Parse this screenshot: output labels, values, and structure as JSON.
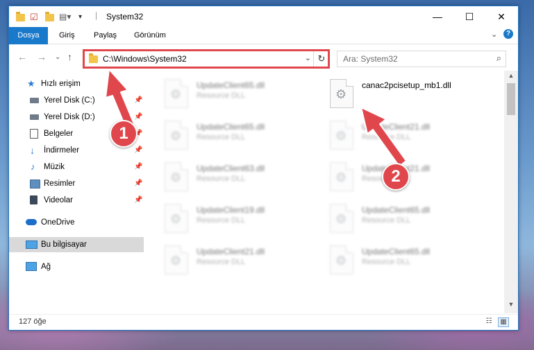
{
  "window": {
    "title": "System32",
    "controls": {
      "minimize": "—",
      "maximize": "☐",
      "close": "✕"
    }
  },
  "ribbon": {
    "tabs": [
      "Dosya",
      "Giriş",
      "Paylaş",
      "Görünüm"
    ]
  },
  "address": {
    "path": "C:\\Windows\\System32"
  },
  "search": {
    "placeholder": "Ara: System32"
  },
  "nav_pane": {
    "items": [
      {
        "label": "Hızlı erişim",
        "icon": "star-icon",
        "pinned": false
      },
      {
        "label": "Yerel Disk (C:)",
        "icon": "drive-icon",
        "pinned": true
      },
      {
        "label": "Yerel Disk (D:)",
        "icon": "drive-icon",
        "pinned": true
      },
      {
        "label": "Belgeler",
        "icon": "documents-icon",
        "pinned": true
      },
      {
        "label": "İndirmeler",
        "icon": "download-icon",
        "pinned": true
      },
      {
        "label": "Müzik",
        "icon": "music-icon",
        "pinned": true
      },
      {
        "label": "Resimler",
        "icon": "pictures-icon",
        "pinned": true
      },
      {
        "label": "Videolar",
        "icon": "videos-icon",
        "pinned": true
      },
      {
        "label": "OneDrive",
        "icon": "cloud-icon",
        "pinned": false
      },
      {
        "label": "Bu bilgisayar",
        "icon": "computer-icon",
        "pinned": false,
        "selected": true
      },
      {
        "label": "Ağ",
        "icon": "network-icon",
        "pinned": false
      }
    ]
  },
  "files": [
    {
      "name": "UpdateClient65.dll",
      "type": "Resource DLL",
      "blurred": true
    },
    {
      "name": "canac2pcisetup_mb1.dll",
      "type": "",
      "blurred": false,
      "highlighted": true
    },
    {
      "name": "UpdateClient65.dll",
      "type": "Resource DLL",
      "blurred": true
    },
    {
      "name": "UpdateClient21.dll",
      "type": "Resource DLL",
      "blurred": true
    },
    {
      "name": "UpdateClient63.dll",
      "type": "Resource DLL",
      "blurred": true
    },
    {
      "name": "UpdateClient21.dll",
      "type": "Resource DLL",
      "blurred": true
    },
    {
      "name": "UpdateClient19.dll",
      "type": "Resource DLL",
      "blurred": true
    },
    {
      "name": "UpdateClient65.dll",
      "type": "Resource DLL",
      "blurred": true
    },
    {
      "name": "UpdateClient21.dll",
      "type": "Resource DLL",
      "blurred": true
    },
    {
      "name": "UpdateClient65.dll",
      "type": "Resource DLL",
      "blurred": true
    }
  ],
  "status": {
    "count": "127 öğe"
  },
  "annotations": {
    "step1": "1",
    "step2": "2",
    "color": "#e0474c"
  }
}
